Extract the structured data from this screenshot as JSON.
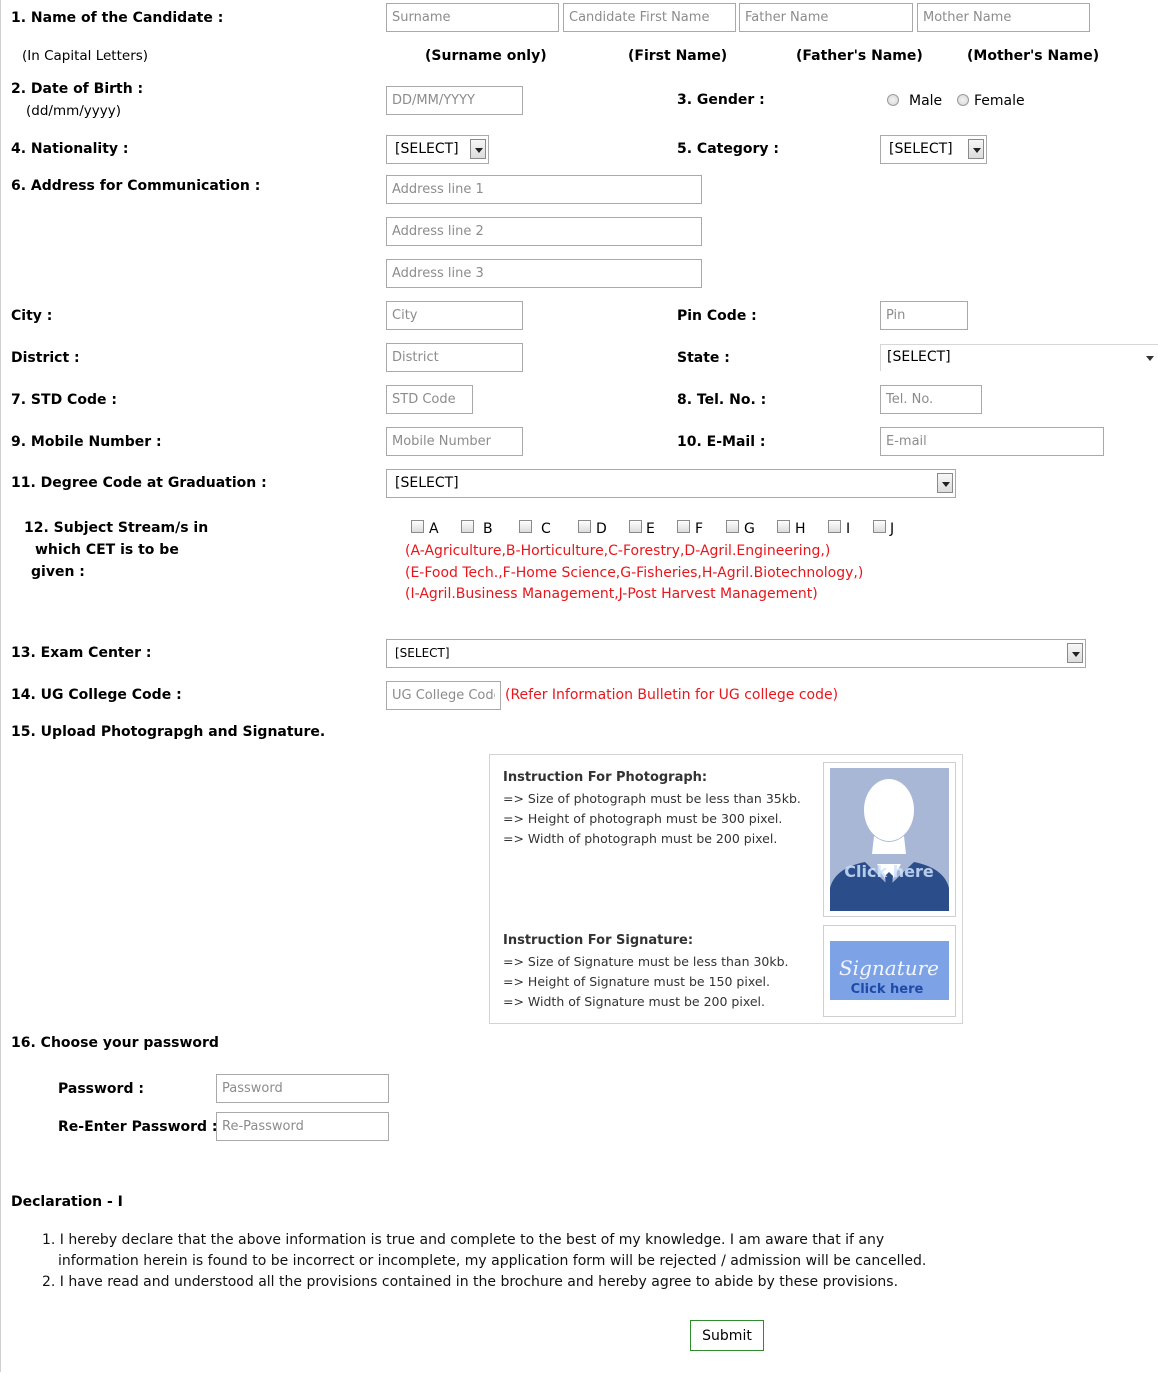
{
  "candidate": {
    "label": "1. Name of the Candidate :",
    "sublabel": "(In Capital Letters)",
    "surname_ph": "Surname",
    "first_ph": "Candidate First Name",
    "father_ph": "Father Name",
    "mother_ph": "Mother Name",
    "cap_surname": "(Surname only)",
    "cap_first": "(First Name)",
    "cap_father": "(Father's Name)",
    "cap_mother": "(Mother's Name)"
  },
  "dob": {
    "label": "2. Date of Birth :",
    "sublabel": "(dd/mm/yyyy)",
    "placeholder": "DD/MM/YYYY"
  },
  "gender": {
    "label": "3. Gender :",
    "male": "Male",
    "female": "Female"
  },
  "nationality": {
    "label": "4. Nationality :",
    "value": "[SELECT]"
  },
  "category": {
    "label": "5. Category :",
    "value": "[SELECT]"
  },
  "address": {
    "label": "6. Address for Communication :",
    "line1_ph": "Address line 1",
    "line2_ph": "Address line 2",
    "line3_ph": "Address line 3"
  },
  "city": {
    "label": "City :",
    "placeholder": "City"
  },
  "pin": {
    "label": "Pin Code :",
    "placeholder": "Pin"
  },
  "district": {
    "label": "District :",
    "placeholder": "District"
  },
  "state": {
    "label": "State :",
    "value": "[SELECT]"
  },
  "std": {
    "label": "7. STD Code :",
    "placeholder": "STD Code"
  },
  "tel": {
    "label": "8. Tel. No. :",
    "placeholder": "Tel. No."
  },
  "mobile": {
    "label": "9. Mobile Number :",
    "placeholder": "Mobile Number"
  },
  "email": {
    "label": "10. E-Mail :",
    "placeholder": "E-mail"
  },
  "degree": {
    "label": "11. Degree Code at Graduation :",
    "value": "[SELECT]"
  },
  "streams": {
    "label_l1": "12. Subject Stream/s in",
    "label_l2": "which CET is to be",
    "label_l3": "given :",
    "options": [
      "A",
      "B",
      "C",
      "D",
      "E",
      "F",
      "G",
      "H",
      "I",
      "J"
    ],
    "legend_l1": "(A-Agriculture,B-Horticulture,C-Forestry,D-Agril.Engineering,)",
    "legend_l2": "(E-Food Tech.,F-Home Science,G-Fisheries,H-Agril.Biotechnology,)",
    "legend_l3": "(I-Agril.Business Management,J-Post Harvest Management)"
  },
  "exam_center": {
    "label": "13. Exam Center :",
    "value": "[SELECT]"
  },
  "ug_college": {
    "label": "14. UG College Code :",
    "placeholder": "UG College Code",
    "note": "(Refer Information Bulletin for UG college code)"
  },
  "upload": {
    "label": "15. Upload Photograpgh and Signature.",
    "photo_title": "Instruction For Photograph:",
    "photo_rules": [
      "=> Size of photograph must be less than 35kb.",
      "=> Height of photograph must be 300 pixel.",
      "=> Width of photograph must be 200 pixel."
    ],
    "photo_click": "Click here",
    "sig_title": "Instruction For Signature:",
    "sig_rules": [
      "=> Size of Signature must be less than 30kb.",
      "=> Height of Signature must be 150 pixel.",
      "=> Width of Signature must be 200 pixel."
    ],
    "sig_text": "Signature",
    "sig_click": "Click here"
  },
  "password": {
    "label": "16. Choose your password",
    "pw_label": "Password :",
    "pw_ph": "Password",
    "repw_label": "Re-Enter Password :",
    "repw_ph": "Re-Password"
  },
  "declaration": {
    "title": "Declaration - I",
    "item1_l1": "1. I hereby declare that the above information is true and complete to the best of my knowledge. I am aware that if any",
    "item1_l2": "information herein is found to be incorrect or incomplete, my application form will be rejected / admission will be cancelled.",
    "item2": "2. I have read and understood all the provisions contained in the brochure and hereby agree to abide by these provisions."
  },
  "submit_label": "Submit",
  "colors": {
    "note_red": "#e8161c",
    "submit_border": "#2e8b2e",
    "avatar_bg": "#a9b7d6",
    "avatar_fg": "#ffffff",
    "sig_bg": "#7ea2e6"
  }
}
